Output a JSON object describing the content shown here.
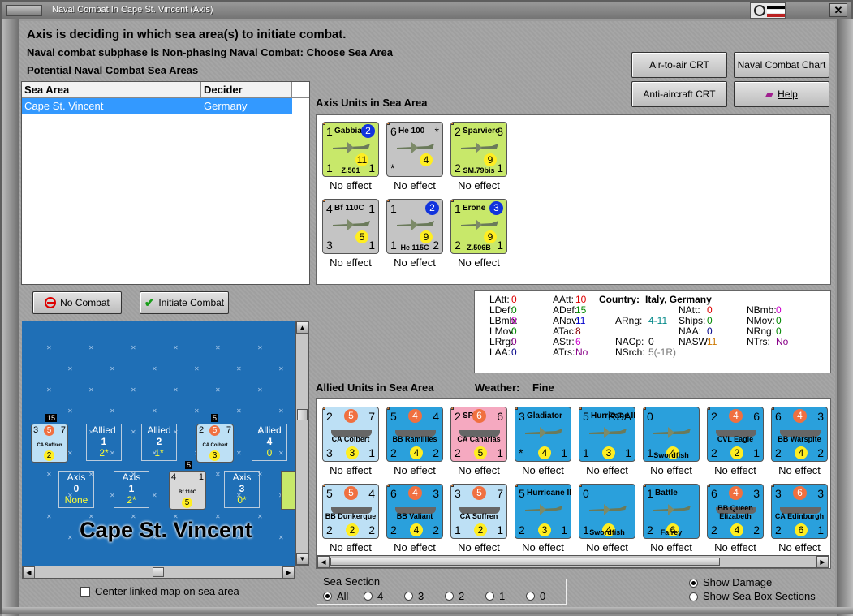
{
  "window": {
    "title": "Naval Combat In Cape St. Vincent (Axis)"
  },
  "header": {
    "line1": "Axis is deciding in which sea area(s) to initiate combat.",
    "line2": "Naval combat subphase is Non-phasing Naval Combat: Choose Sea Area",
    "line3": "Potential Naval Combat Sea Areas"
  },
  "table": {
    "columns": [
      "Sea Area",
      "Decider"
    ],
    "rows": [
      {
        "sea": "Cape St. Vincent",
        "decider": "Germany"
      }
    ]
  },
  "buttons": {
    "air_to_air": "Air-to-air CRT",
    "naval_chart": "Naval Combat Chart",
    "anti_aircraft": "Anti-aircraft CRT",
    "help": "Help",
    "no_combat": "No Combat",
    "initiate": "Initiate Combat"
  },
  "axis": {
    "label": "Axis Units in Sea Area",
    "effect": "No effect",
    "units": [
      {
        "name": "Gabbiano",
        "tl": "1",
        "circ": "2",
        "bl": "1",
        "mid": "11",
        "br": "1",
        "sub": "Z.501",
        "bg": "#c8e86a"
      },
      {
        "name": "He 100",
        "tl": "6",
        "tr": "*",
        "bl": "*",
        "mid": "4",
        "br": "",
        "sub": "",
        "bg": "#c4c4c4"
      },
      {
        "name": "Sparviero",
        "tl": "2",
        "tr": "3",
        "bl": "2",
        "mid": "9",
        "br": "1",
        "sub": "SM.79bis",
        "bg": "#c8e86a"
      },
      {
        "name": "Bf 110C",
        "tl": "4",
        "tr": "1",
        "bl": "3",
        "mid": "5",
        "br": "1",
        "sub": "",
        "bg": "#c4c4c4"
      },
      {
        "name": "",
        "tl": "1",
        "circ": "2",
        "bl": "1",
        "mid": "9",
        "br": "2",
        "sub": "He 115C",
        "bg": "#c4c4c4"
      },
      {
        "name": "Erone",
        "tl": "1",
        "circ": "3",
        "bl": "2",
        "mid": "9",
        "br": "1",
        "sub": "Z.506B",
        "bg": "#c8e86a"
      }
    ]
  },
  "stats": {
    "country_label": "Country:",
    "country": "Italy, Germany",
    "items": [
      {
        "k": "LAtt:",
        "v": "0",
        "c": "#d00"
      },
      {
        "k": "LDef:",
        "v": "0",
        "c": "#080"
      },
      {
        "k": "LBmb:",
        "v": "0",
        "c": "#c0c"
      },
      {
        "k": "LMov:",
        "v": "0",
        "c": "#080"
      },
      {
        "k": "LRrg:",
        "v": "0",
        "c": "#808"
      },
      {
        "k": "LAA:",
        "v": "0",
        "c": "#008"
      },
      {
        "k": "AAtt:",
        "v": "10",
        "c": "#d00"
      },
      {
        "k": "ADef:",
        "v": "15",
        "c": "#080"
      },
      {
        "k": "ANav:",
        "v": "11",
        "c": "#00c"
      },
      {
        "k": "ATac:",
        "v": "8",
        "c": "#800"
      },
      {
        "k": "AStr:",
        "v": "6",
        "c": "#c0c"
      },
      {
        "k": "ATrs:",
        "v": "No",
        "c": "#808"
      },
      {
        "k": "ARng:",
        "v": "4-11",
        "c": "#088"
      },
      {
        "k": "NACp:",
        "v": "0",
        "c": "#000"
      },
      {
        "k": "NSrch:",
        "v": "5(-1R)",
        "c": "#777"
      },
      {
        "k": "NAtt:",
        "v": "0",
        "c": "#d00"
      },
      {
        "k": "Ships:",
        "v": "0",
        "c": "#080"
      },
      {
        "k": "NAA:",
        "v": "0",
        "c": "#008"
      },
      {
        "k": "NASW:",
        "v": "11",
        "c": "#c70"
      },
      {
        "k": "NBmb:",
        "v": "0",
        "c": "#c0c"
      },
      {
        "k": "NMov:",
        "v": "0",
        "c": "#080"
      },
      {
        "k": "NRng:",
        "v": "0",
        "c": "#080"
      },
      {
        "k": "NTrs:",
        "v": "No",
        "c": "#808"
      }
    ]
  },
  "allied": {
    "label": "Allied Units in Sea Area",
    "weather_label": "Weather:",
    "weather": "Fine",
    "effect": "No effect",
    "units": [
      {
        "name": "",
        "tl": "2",
        "circ": "5",
        "tr": "7",
        "bl": "3",
        "mid": "3",
        "br": "1",
        "sub": "CA Colbert",
        "bg": "#bde0f5",
        "k": "ship"
      },
      {
        "name": "",
        "tl": "5",
        "circ": "4",
        "tr": "4",
        "bl": "2",
        "mid": "4",
        "br": "2",
        "sub": "BB Ramillies",
        "bg": "#2aa0dc",
        "k": "ship"
      },
      {
        "name": "SPA",
        "tl": "2",
        "circ": "6",
        "tr": "6",
        "bl": "2",
        "mid": "5",
        "br": "1",
        "sub": "CA Canarias",
        "bg": "#f5a9c0",
        "k": "ship"
      },
      {
        "name": "Gladiator",
        "tl": "3",
        "tr": "",
        "bl": "*",
        "mid": "4",
        "br": "1",
        "sub": "",
        "bg": "#2aa0dc",
        "k": "plane"
      },
      {
        "name": "Hurricane IIA",
        "tl": "5",
        "tr": "RSA",
        "bl": "1",
        "mid": "3",
        "br": "1",
        "sub": "",
        "bg": "#2aa0dc",
        "k": "plane"
      },
      {
        "name": "",
        "tl": "0",
        "tr": "",
        "bl": "1",
        "mid": "4",
        "br": "",
        "sub": "Swordfish",
        "bg": "#2aa0dc",
        "k": "plane"
      },
      {
        "name": "",
        "tl": "2",
        "circ": "4",
        "tr": "6",
        "bl": "2",
        "mid": "2",
        "br": "1",
        "sub": "CVL Eagle",
        "bg": "#2aa0dc",
        "k": "ship"
      },
      {
        "name": "",
        "tl": "6",
        "circ": "4",
        "tr": "3",
        "bl": "2",
        "mid": "4",
        "br": "2",
        "sub": "BB Warspite",
        "bg": "#2aa0dc",
        "k": "ship"
      },
      {
        "name": "",
        "tl": "5",
        "circ": "5",
        "tr": "4",
        "bl": "2",
        "mid": "2",
        "br": "2",
        "sub": "BB Dunkerque",
        "bg": "#bde0f5",
        "k": "ship"
      },
      {
        "name": "",
        "tl": "6",
        "circ": "4",
        "tr": "3",
        "bl": "2",
        "mid": "4",
        "br": "2",
        "sub": "BB Valiant",
        "bg": "#2aa0dc",
        "k": "ship"
      },
      {
        "name": "",
        "tl": "3",
        "circ": "5",
        "tr": "7",
        "bl": "1",
        "mid": "2",
        "br": "1",
        "sub": "CA Suffren",
        "bg": "#bde0f5",
        "k": "ship"
      },
      {
        "name": "Hurricane IIB",
        "tl": "5",
        "tr": "",
        "bl": "2",
        "mid": "3",
        "br": "1",
        "sub": "",
        "bg": "#2aa0dc",
        "k": "plane"
      },
      {
        "name": "",
        "tl": "0",
        "tr": "",
        "bl": "1",
        "mid": "4",
        "br": "",
        "sub": "Swordfish",
        "bg": "#2aa0dc",
        "k": "plane"
      },
      {
        "name": "Battle",
        "tl": "1",
        "tr": "",
        "bl": "2",
        "mid": "6",
        "br": "",
        "sub": "Fairey",
        "bg": "#2aa0dc",
        "k": "plane"
      },
      {
        "name": "",
        "tl": "6",
        "circ": "4",
        "tr": "3",
        "bl": "2",
        "mid": "4",
        "br": "2",
        "sub": "BB Queen Elizabeth",
        "bg": "#2aa0dc",
        "k": "ship"
      },
      {
        "name": "",
        "tl": "3",
        "circ": "6",
        "tr": "3",
        "bl": "2",
        "mid": "6",
        "br": "1",
        "sub": "CA Edinburgh",
        "bg": "#2aa0dc",
        "k": "ship"
      }
    ]
  },
  "map": {
    "title": "Cape St. Vincent",
    "allied_boxes": [
      {
        "label": "Allied",
        "v": "1",
        "s": "2*"
      },
      {
        "label": "Allied",
        "v": "2",
        "s": "1*"
      },
      {
        "label": "Allied",
        "v": "4",
        "s": "0"
      }
    ],
    "axis_boxes": [
      {
        "label": "Axis",
        "v": "0",
        "s": "None"
      },
      {
        "label": "Axis",
        "v": "1",
        "s": "2*"
      },
      {
        "label": "Axis",
        "v": "3",
        "s": "0*"
      }
    ],
    "stack_labels": [
      "15",
      "5",
      "5"
    ],
    "counters": [
      {
        "tl": "3",
        "c": "5",
        "tr": "7",
        "b": "2",
        "sub": "CA Suffren"
      },
      {
        "tl": "2",
        "c": "5",
        "tr": "7",
        "b": "3",
        "sub": "CA Colbert"
      },
      {
        "tl": "4",
        "c": "",
        "tr": "1",
        "b": "5",
        "sub": "Bf 110C"
      }
    ]
  },
  "center_linked": "Center linked map on sea area",
  "sea_section": {
    "label": "Sea Section",
    "options": [
      "All",
      "4",
      "3",
      "2",
      "1",
      "0"
    ]
  },
  "show": {
    "damage": "Show Damage",
    "boxes": "Show Sea Box Sections"
  }
}
